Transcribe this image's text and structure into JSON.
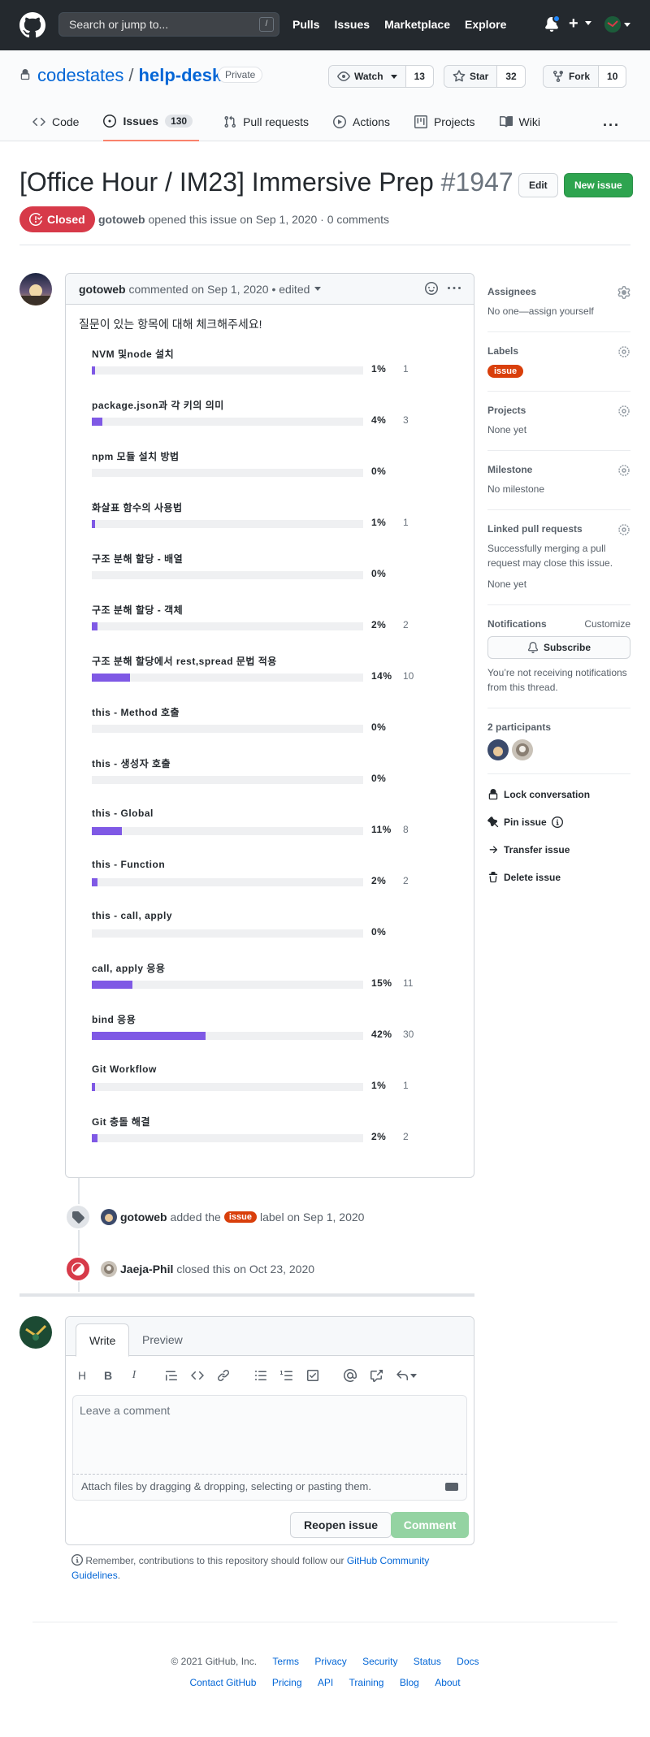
{
  "header": {
    "search_placeholder": "Search or jump to...",
    "search_key": "/",
    "nav": [
      "Pulls",
      "Issues",
      "Marketplace",
      "Explore"
    ],
    "plus": "+"
  },
  "repo": {
    "owner": "codestates",
    "separator": "/",
    "name": "help-desk",
    "visibility": "Private",
    "watch": {
      "label": "Watch",
      "count": "13"
    },
    "star": {
      "label": "Star",
      "count": "32"
    },
    "fork": {
      "label": "Fork",
      "count": "10"
    },
    "tabs": [
      {
        "label": "Code"
      },
      {
        "label": "Issues",
        "counter": "130"
      },
      {
        "label": "Pull requests"
      },
      {
        "label": "Actions"
      },
      {
        "label": "Projects"
      },
      {
        "label": "Wiki"
      }
    ],
    "more": "···"
  },
  "issue": {
    "title": "[Office Hour / IM23] Immersive Prep",
    "number": "#1947",
    "edit_label": "Edit",
    "new_label": "New issue",
    "state": "Closed",
    "author": "gotoweb",
    "meta": "opened this issue on Sep 1, 2020 · 0 comments"
  },
  "comment": {
    "author": "gotoweb",
    "meta": "commented on Sep 1, 2020",
    "edited": "• edited",
    "intro": "질문이 있는 항목에 대해 체크해주세요!",
    "poll": [
      {
        "label": "NVM 및node 설치",
        "pct": "1%",
        "count": "1",
        "value": 1
      },
      {
        "label": "package.json과 각 키의 의미",
        "pct": "4%",
        "count": "3",
        "value": 4
      },
      {
        "label": "npm 모듈 설치 방법",
        "pct": "0%",
        "count": "",
        "value": 0
      },
      {
        "label": "화살표 함수의 사용법",
        "pct": "1%",
        "count": "1",
        "value": 1
      },
      {
        "label": "구조 분해 할당 - 배열",
        "pct": "0%",
        "count": "",
        "value": 0
      },
      {
        "label": "구조 분해 할당 - 객체",
        "pct": "2%",
        "count": "2",
        "value": 2
      },
      {
        "label": "구조 분해 할당에서 rest,spread 문법 적용",
        "pct": "14%",
        "count": "10",
        "value": 14
      },
      {
        "label": "this - Method 호출",
        "pct": "0%",
        "count": "",
        "value": 0
      },
      {
        "label": "this - 생성자 호출",
        "pct": "0%",
        "count": "",
        "value": 0
      },
      {
        "label": "this - Global",
        "pct": "11%",
        "count": "8",
        "value": 11
      },
      {
        "label": "this - Function",
        "pct": "2%",
        "count": "2",
        "value": 2
      },
      {
        "label": "this - call, apply",
        "pct": "0%",
        "count": "",
        "value": 0
      },
      {
        "label": "call, apply 응용",
        "pct": "15%",
        "count": "11",
        "value": 15
      },
      {
        "label": "bind 응용",
        "pct": "42%",
        "count": "30",
        "value": 42
      },
      {
        "label": "Git Workflow",
        "pct": "1%",
        "count": "1",
        "value": 1
      },
      {
        "label": "Git 충돌 해결",
        "pct": "2%",
        "count": "2",
        "value": 2
      }
    ]
  },
  "timeline": {
    "labeled": {
      "actor": "gotoweb",
      "pre": "added the",
      "label": "issue",
      "post": "label on Sep 1, 2020"
    },
    "closed": {
      "actor": "Jaeja-Phil",
      "text": "closed this on Oct 23, 2020"
    }
  },
  "new_comment": {
    "tab_write": "Write",
    "tab_preview": "Preview",
    "placeholder": "Leave a comment",
    "attach": "Attach files by dragging & dropping, selecting or pasting them.",
    "reopen": "Reopen issue",
    "submit": "Comment",
    "reminder": "Remember, contributions to this repository should follow our",
    "reminder_link": "GitHub Community Guidelines",
    "reminder_end": "."
  },
  "sidebar": {
    "assignees": {
      "title": "Assignees",
      "value": "No one—assign yourself"
    },
    "labels": {
      "title": "Labels",
      "value": "issue"
    },
    "projects": {
      "title": "Projects",
      "value": "None yet"
    },
    "milestone": {
      "title": "Milestone",
      "value": "No milestone"
    },
    "linked": {
      "title": "Linked pull requests",
      "desc": "Successfully merging a pull request may close this issue.",
      "value": "None yet"
    },
    "notifications": {
      "title": "Notifications",
      "customize": "Customize",
      "subscribe": "Subscribe",
      "desc": "You’re not receiving notifications from this thread."
    },
    "participants": {
      "title": "2 participants"
    },
    "actions": [
      "Lock conversation",
      "Pin issue",
      "Transfer issue",
      "Delete issue"
    ]
  },
  "footer": {
    "copyright": "© 2021 GitHub, Inc.",
    "row1": [
      "Terms",
      "Privacy",
      "Security",
      "Status",
      "Docs"
    ],
    "row2": [
      "Contact GitHub",
      "Pricing",
      "API",
      "Training",
      "Blog",
      "About"
    ]
  },
  "colors": {
    "poll_bar": "#7f59e5",
    "closed": "#d73a49",
    "label": "#d93f0b",
    "primary": "#2ea44f"
  }
}
